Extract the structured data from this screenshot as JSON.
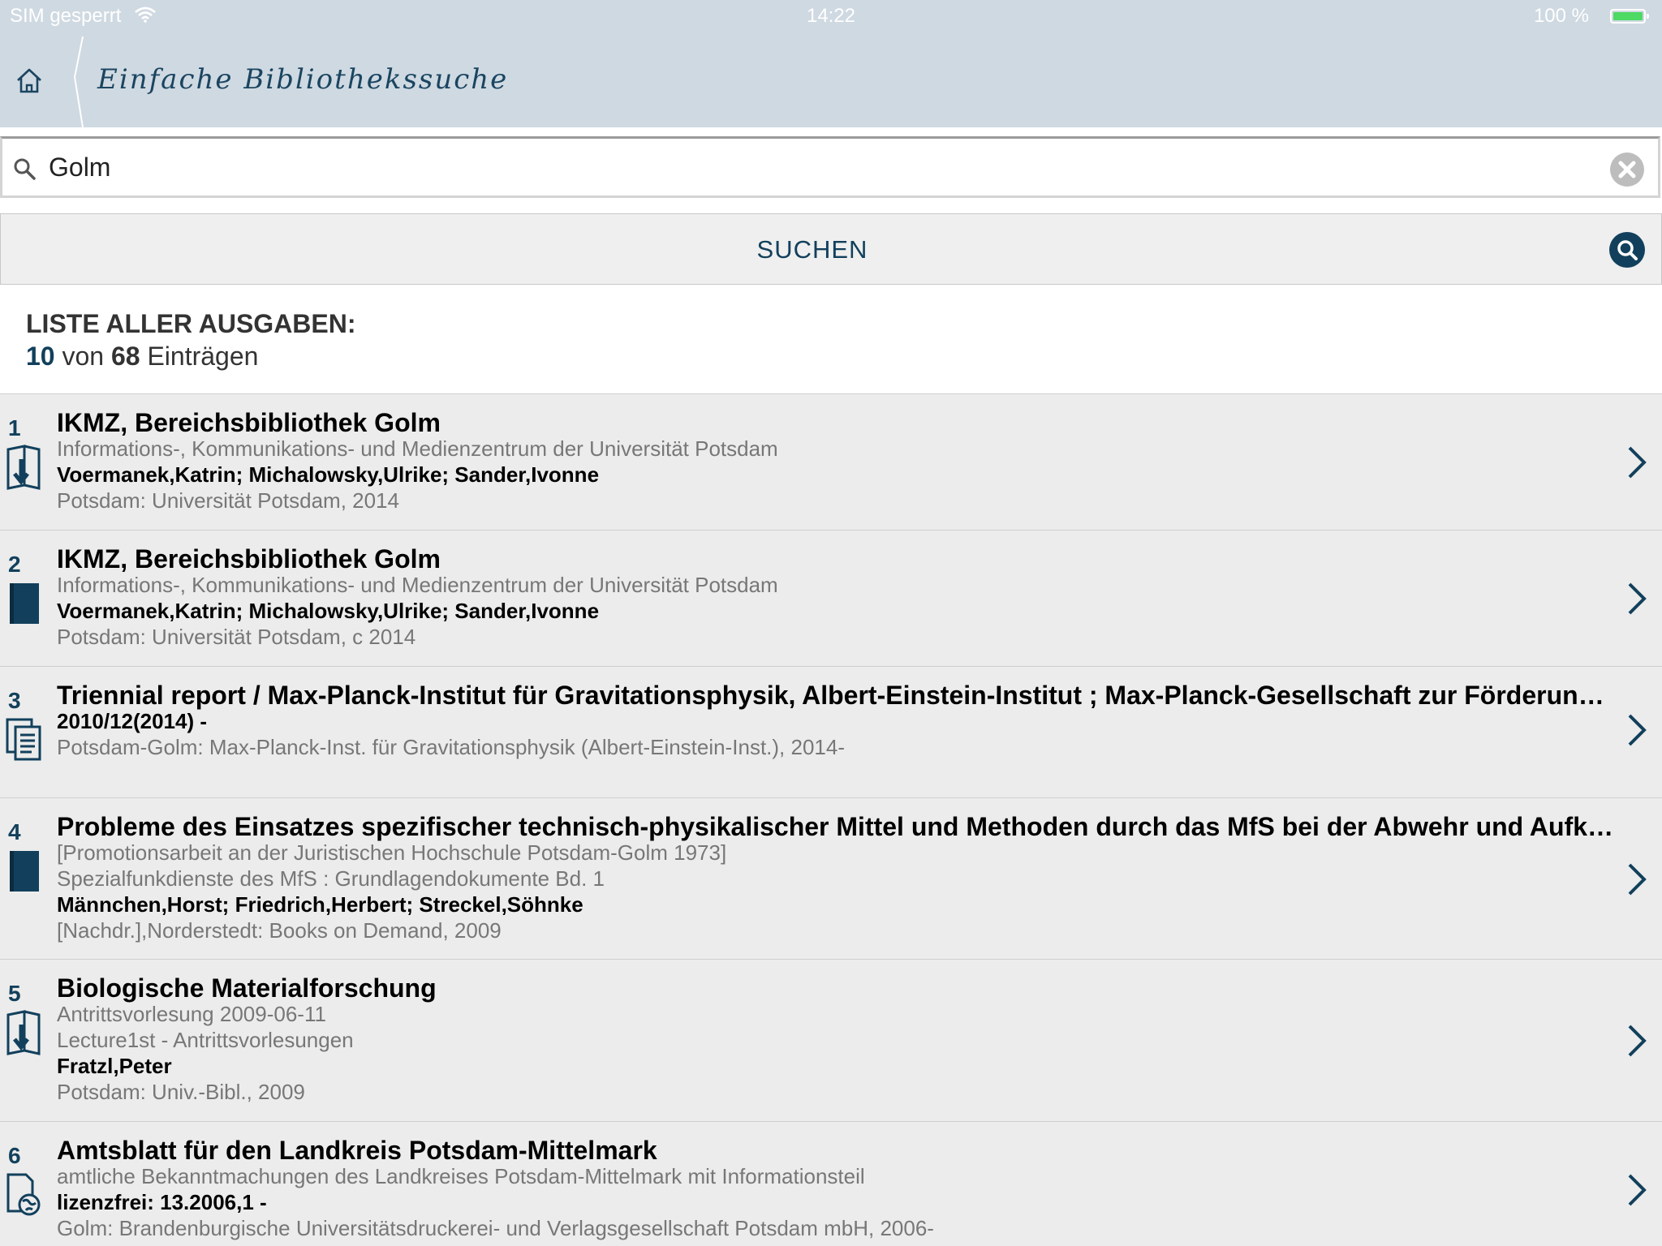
{
  "status_bar": {
    "carrier": "SIM gesperrt",
    "time": "14:22",
    "battery": "100 %"
  },
  "nav": {
    "title": "Einfache Bibliothekssuche"
  },
  "search": {
    "value": "Golm",
    "button_label": "SUCHEN"
  },
  "results": {
    "heading": "LISTE ALLER AUSGABEN:",
    "shown": "10",
    "von": "von",
    "total": "68",
    "entries_label": "Einträgen",
    "items": [
      {
        "number": "1",
        "icon": "ebook-download-icon",
        "lines": [
          {
            "text": "IKMZ, Bereichsbibliothek Golm",
            "style": "title"
          },
          {
            "text": "Informations-, Kommunikations- und Medienzentrum der Universität Potsdam",
            "style": "normal"
          },
          {
            "text": "Voermanek,Katrin; Michalowsky,Ulrike; Sander,Ivonne",
            "style": "bold"
          },
          {
            "text": "Potsdam: Universität Potsdam, 2014",
            "style": "normal"
          }
        ]
      },
      {
        "number": "2",
        "icon": "book-icon",
        "lines": [
          {
            "text": "IKMZ, Bereichsbibliothek Golm",
            "style": "title"
          },
          {
            "text": "Informations-, Kommunikations- und Medienzentrum der Universität Potsdam",
            "style": "normal"
          },
          {
            "text": "Voermanek,Katrin; Michalowsky,Ulrike; Sander,Ivonne",
            "style": "bold"
          },
          {
            "text": "Potsdam: Universität Potsdam, c 2014",
            "style": "normal"
          }
        ]
      },
      {
        "number": "3",
        "icon": "periodical-icon",
        "lines": [
          {
            "text": "Triennial report / Max-Planck-Institut für Gravitationsphysik, Albert-Einstein-Institut ; Max-Planck-Gesellschaft zur Förderung der Wissenschaften",
            "style": "title"
          },
          {
            "text": "2010/12(2014) -",
            "style": "bold"
          },
          {
            "text": "Potsdam-Golm: Max-Planck-Inst. für Gravitationsphysik (Albert-Einstein-Inst.), 2014-",
            "style": "normal"
          }
        ]
      },
      {
        "number": "4",
        "icon": "book-icon",
        "lines": [
          {
            "text": "Probleme des Einsatzes spezifischer technisch-physikalischer Mittel und Methoden durch das MfS bei der Abwehr und Aufklärung",
            "style": "title"
          },
          {
            "text": "[Promotionsarbeit an der Juristischen Hochschule Potsdam-Golm 1973]",
            "style": "normal"
          },
          {
            "text": "Spezialfunkdienste des MfS : Grundlagendokumente Bd. 1",
            "style": "normal"
          },
          {
            "text": "Männchen,Horst; Friedrich,Herbert; Streckel,Söhnke",
            "style": "bold"
          },
          {
            "text": "[Nachdr.],Norderstedt: Books on Demand, 2009",
            "style": "normal"
          }
        ]
      },
      {
        "number": "5",
        "icon": "ebook-download-icon",
        "lines": [
          {
            "text": "Biologische Materialforschung",
            "style": "title"
          },
          {
            "text": "Antrittsvorlesung 2009-06-11",
            "style": "normal"
          },
          {
            "text": "Lecture1st - Antrittsvorlesungen",
            "style": "normal"
          },
          {
            "text": "Fratzl,Peter",
            "style": "bold"
          },
          {
            "text": "Potsdam: Univ.-Bibl., 2009",
            "style": "normal"
          }
        ]
      },
      {
        "number": "6",
        "icon": "online-resource-icon",
        "lines": [
          {
            "text": "Amtsblatt für den Landkreis Potsdam-Mittelmark",
            "style": "title"
          },
          {
            "text": "amtliche Bekanntmachungen des Landkreises Potsdam-Mittelmark mit Informationsteil",
            "style": "normal"
          },
          {
            "text": "lizenzfrei: 13.2006,1 -",
            "style": "bold"
          },
          {
            "text": "Golm: Brandenburgische Universitätsdruckerei- und Verlagsgesellschaft Potsdam mbH, 2006-",
            "style": "normal"
          }
        ]
      }
    ]
  }
}
